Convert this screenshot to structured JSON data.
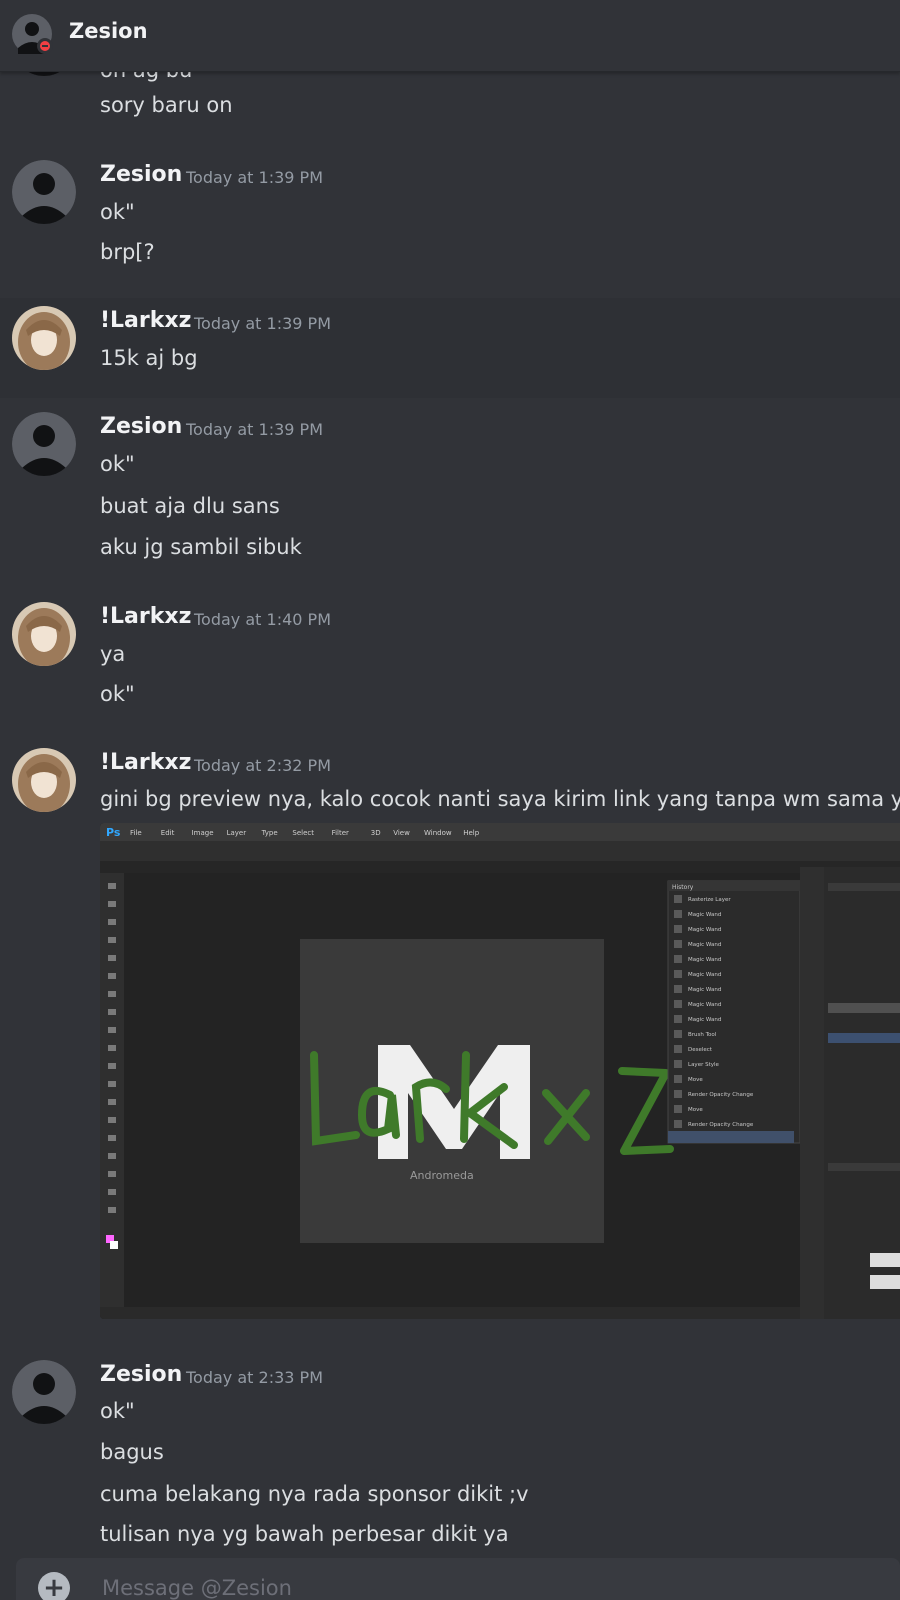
{
  "header": {
    "dm_name": "Zesion"
  },
  "messages": {
    "top_partial": {
      "line_cut": "on ag bu",
      "line": "sory baru on"
    },
    "g1": {
      "author": "Zesion",
      "time": "Today at 1:39 PM",
      "lines": [
        "ok\"",
        "brp[?"
      ]
    },
    "g2": {
      "author": "!Larkxz",
      "time": "Today at 1:39 PM",
      "lines": [
        "15k aj bg"
      ]
    },
    "g3": {
      "author": "Zesion",
      "time": "Today at 1:39 PM",
      "lines": [
        "ok\"",
        "buat aja dlu sans",
        "aku jg sambil sibuk"
      ]
    },
    "g4": {
      "author": "!Larkxz",
      "time": "Today at 1:40 PM",
      "lines": [
        "ya",
        "ok\""
      ]
    },
    "g5": {
      "author": "!Larkxz",
      "time": "Today at 2:32 PM",
      "lines": [
        "gini bg preview nya, kalo cocok nanti saya kirim link yang tanpa wm sama y"
      ]
    },
    "g6": {
      "author": "Zesion",
      "time": "Today at 2:33 PM",
      "lines": [
        "ok\"",
        "bagus",
        "cuma belakang nya rada sponsor dikit ;v",
        "tulisan nya yg bawah perbesar dikit ya"
      ]
    }
  },
  "attachment": {
    "app_logo": "Ps",
    "menu": [
      "File",
      "Edit",
      "Image",
      "Layer",
      "Type",
      "Select",
      "Filter",
      "3D",
      "View",
      "Window",
      "Help"
    ],
    "canvas_logo_letter": "M",
    "canvas_caption": "Andromeda",
    "watermark": "Larkxz",
    "watermark_color": "#3f7a2a",
    "history_title": "History",
    "history_items": [
      "Rasterize Layer",
      "Magic Wand",
      "Magic Wand",
      "Magic Wand",
      "Magic Wand",
      "Magic Wand",
      "Magic Wand",
      "Magic Wand",
      "Magic Wand",
      "Brush Tool",
      "Deselect",
      "Layer Style",
      "Move",
      "Render Opacity Change",
      "Move",
      "Render Opacity Change"
    ]
  },
  "composer": {
    "placeholder": "Message @Zesion"
  },
  "colors": {
    "background": "#313338",
    "accent_status_dnd": "#f23f43",
    "timestamp": "#949ba4"
  }
}
